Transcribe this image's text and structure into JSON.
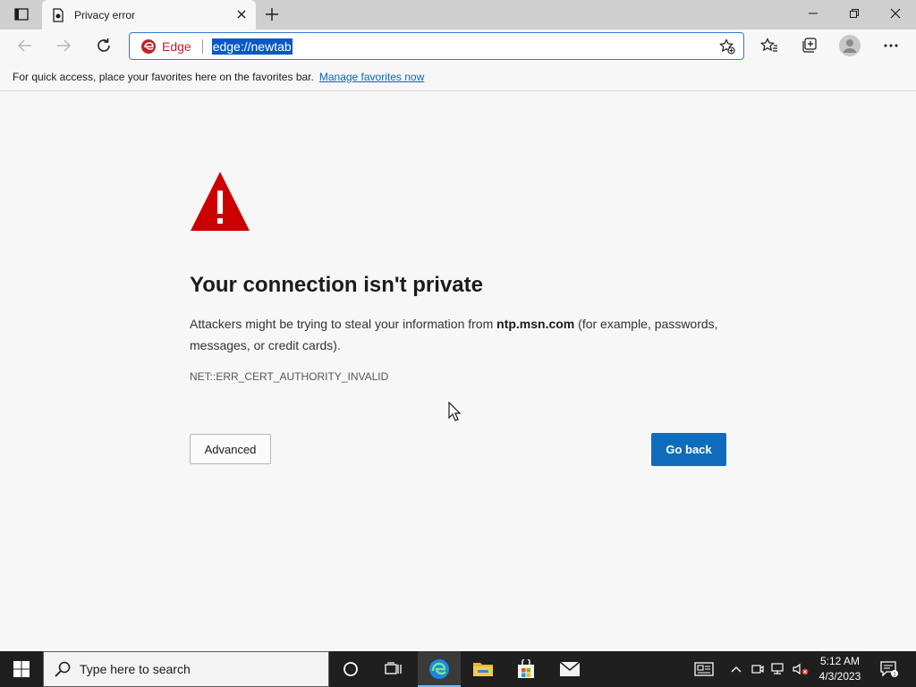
{
  "tab": {
    "title": "Privacy error"
  },
  "address_bar": {
    "site_label": "Edge",
    "url": "edge://newtab"
  },
  "favorites_bar": {
    "message": "For quick access, place your favorites here on the favorites bar.",
    "link": "Manage favorites now"
  },
  "error_page": {
    "heading": "Your connection isn't private",
    "desc_before": "Attackers might be trying to steal your information from ",
    "desc_host": "ntp.msn.com",
    "desc_after": " (for example, passwords, messages, or credit cards).",
    "error_code": "NET::ERR_CERT_AUTHORITY_INVALID",
    "advanced_label": "Advanced",
    "go_back_label": "Go back"
  },
  "taskbar": {
    "search_placeholder": "Type here to search",
    "time": "5:12 AM",
    "date": "4/3/2023"
  },
  "colors": {
    "accent": "#0f6cbd",
    "warning": "#cc0000",
    "url_highlight": "#0a58c7",
    "edge_red": "#c0202a"
  }
}
